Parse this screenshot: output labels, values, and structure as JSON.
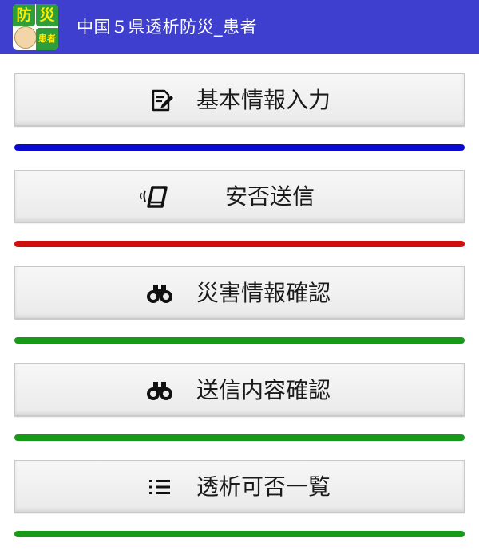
{
  "app_bar": {
    "title": "中国５県透析防災_患者",
    "logo_chars": [
      "防",
      "災",
      "患者"
    ],
    "color": "#3f3fcf"
  },
  "menu": [
    {
      "label": "基本情報入力",
      "icon": "edit-document-icon",
      "accent": "#0a0ad0"
    },
    {
      "label": "安否送信",
      "icon": "phone-vibrate-icon",
      "accent": "#d01010"
    },
    {
      "label": "災害情報確認",
      "icon": "binoculars-icon",
      "accent": "#179a17"
    },
    {
      "label": "送信内容確認",
      "icon": "binoculars-icon",
      "accent": "#179a17"
    },
    {
      "label": "透析可否一覧",
      "icon": "list-icon",
      "accent": "#179a17"
    }
  ]
}
